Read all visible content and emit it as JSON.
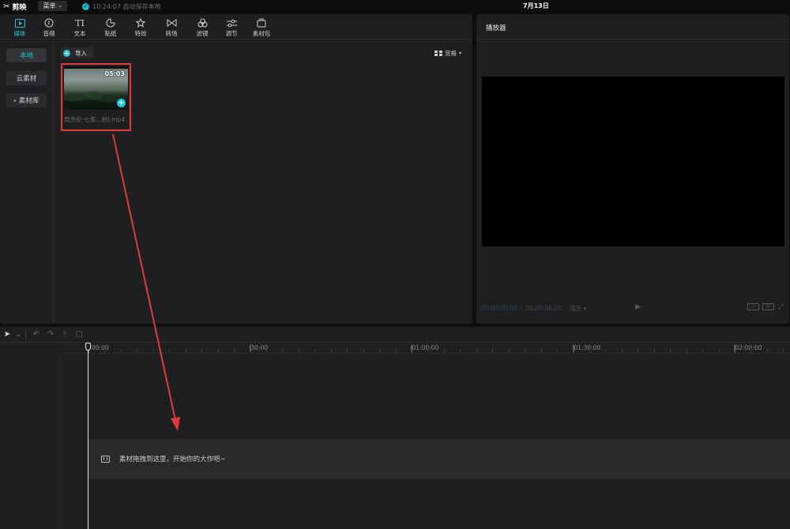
{
  "app": {
    "name": "剪映",
    "menu_label": "菜单",
    "save_status": "10:24:07 自动保存本地",
    "date": "7月13日"
  },
  "toolbar": {
    "items": [
      {
        "label": "媒体",
        "icon": "media-icon",
        "active": true
      },
      {
        "label": "音频",
        "icon": "audio-icon"
      },
      {
        "label": "文本",
        "icon": "text-icon"
      },
      {
        "label": "贴纸",
        "icon": "sticker-icon"
      },
      {
        "label": "特效",
        "icon": "effects-icon"
      },
      {
        "label": "转场",
        "icon": "transition-icon"
      },
      {
        "label": "滤镜",
        "icon": "filter-icon"
      },
      {
        "label": "调节",
        "icon": "adjust-icon"
      },
      {
        "label": "素材包",
        "icon": "asset-pack-icon"
      }
    ]
  },
  "sidebar": {
    "items": [
      {
        "label": "本地",
        "active": true
      },
      {
        "label": "云素材"
      },
      {
        "label": "素材库",
        "expandable": true
      }
    ]
  },
  "media": {
    "import_label": "导入",
    "view_label": "宫格",
    "clip": {
      "duration": "05:03",
      "filename": "周杰伦-七里...拍).mp4"
    }
  },
  "player": {
    "title": "播放器",
    "timecode_current": "00:00:00:00",
    "timecode_total": "00:00:00:00",
    "ratio_label": "适应"
  },
  "timeline": {
    "ruler_labels": [
      "00:00",
      "|30:00",
      "|01:00:00",
      "|01:30:00",
      "|02:00:00"
    ],
    "drop_hint": "素材拖拽到这里，开始你的大作吧~"
  },
  "colors": {
    "accent": "#1fc5d5",
    "highlight_border": "#e23a3a",
    "panel_bg": "#1f1f22",
    "app_bg": "#0e0e10"
  }
}
